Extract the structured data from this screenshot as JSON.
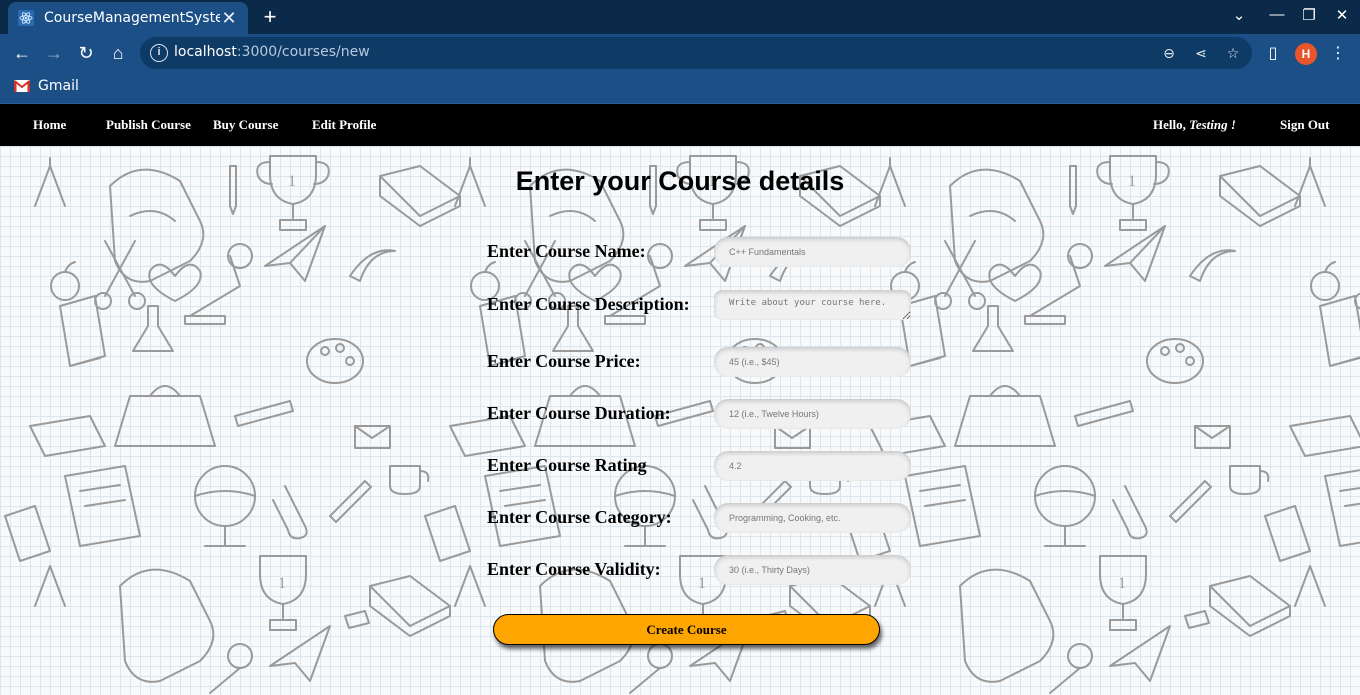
{
  "browser": {
    "tab_title": "CourseManagementSyste",
    "url_host": "localhost",
    "url_path": ":3000/courses/new",
    "profile_initial": "H",
    "bookmark_label": "Gmail",
    "colors": {
      "frame": "#0b2a4a",
      "toolbar": "#1b4f86",
      "avatar": "#e8552b"
    }
  },
  "nav": {
    "links": [
      "Home",
      "Publish Course",
      "Buy Course",
      "Edit Profile"
    ],
    "greeting_prefix": "Hello, ",
    "greeting_name": "Testing !",
    "signout_label": "Sign Out"
  },
  "form": {
    "title": "Enter your Course details",
    "fields": [
      {
        "label": "Enter Course Name:",
        "placeholder": "C++ Fundamentals"
      },
      {
        "label": "Enter Course Description:",
        "placeholder": "Write about your course here."
      },
      {
        "label": "Enter Course Price:",
        "placeholder": "45 (i.e., $45)"
      },
      {
        "label": "Enter Course Duration:",
        "placeholder": "12 (i.e., Twelve Hours)"
      },
      {
        "label": "Enter Course Rating",
        "placeholder": "4.2"
      },
      {
        "label": "Enter Course Category:",
        "placeholder": "Programming, Cooking, etc."
      },
      {
        "label": "Enter Course Validity:",
        "placeholder": "30 (i.e., Thirty Days)"
      }
    ],
    "submit_label": "Create Course",
    "accent": "#ffa500"
  }
}
